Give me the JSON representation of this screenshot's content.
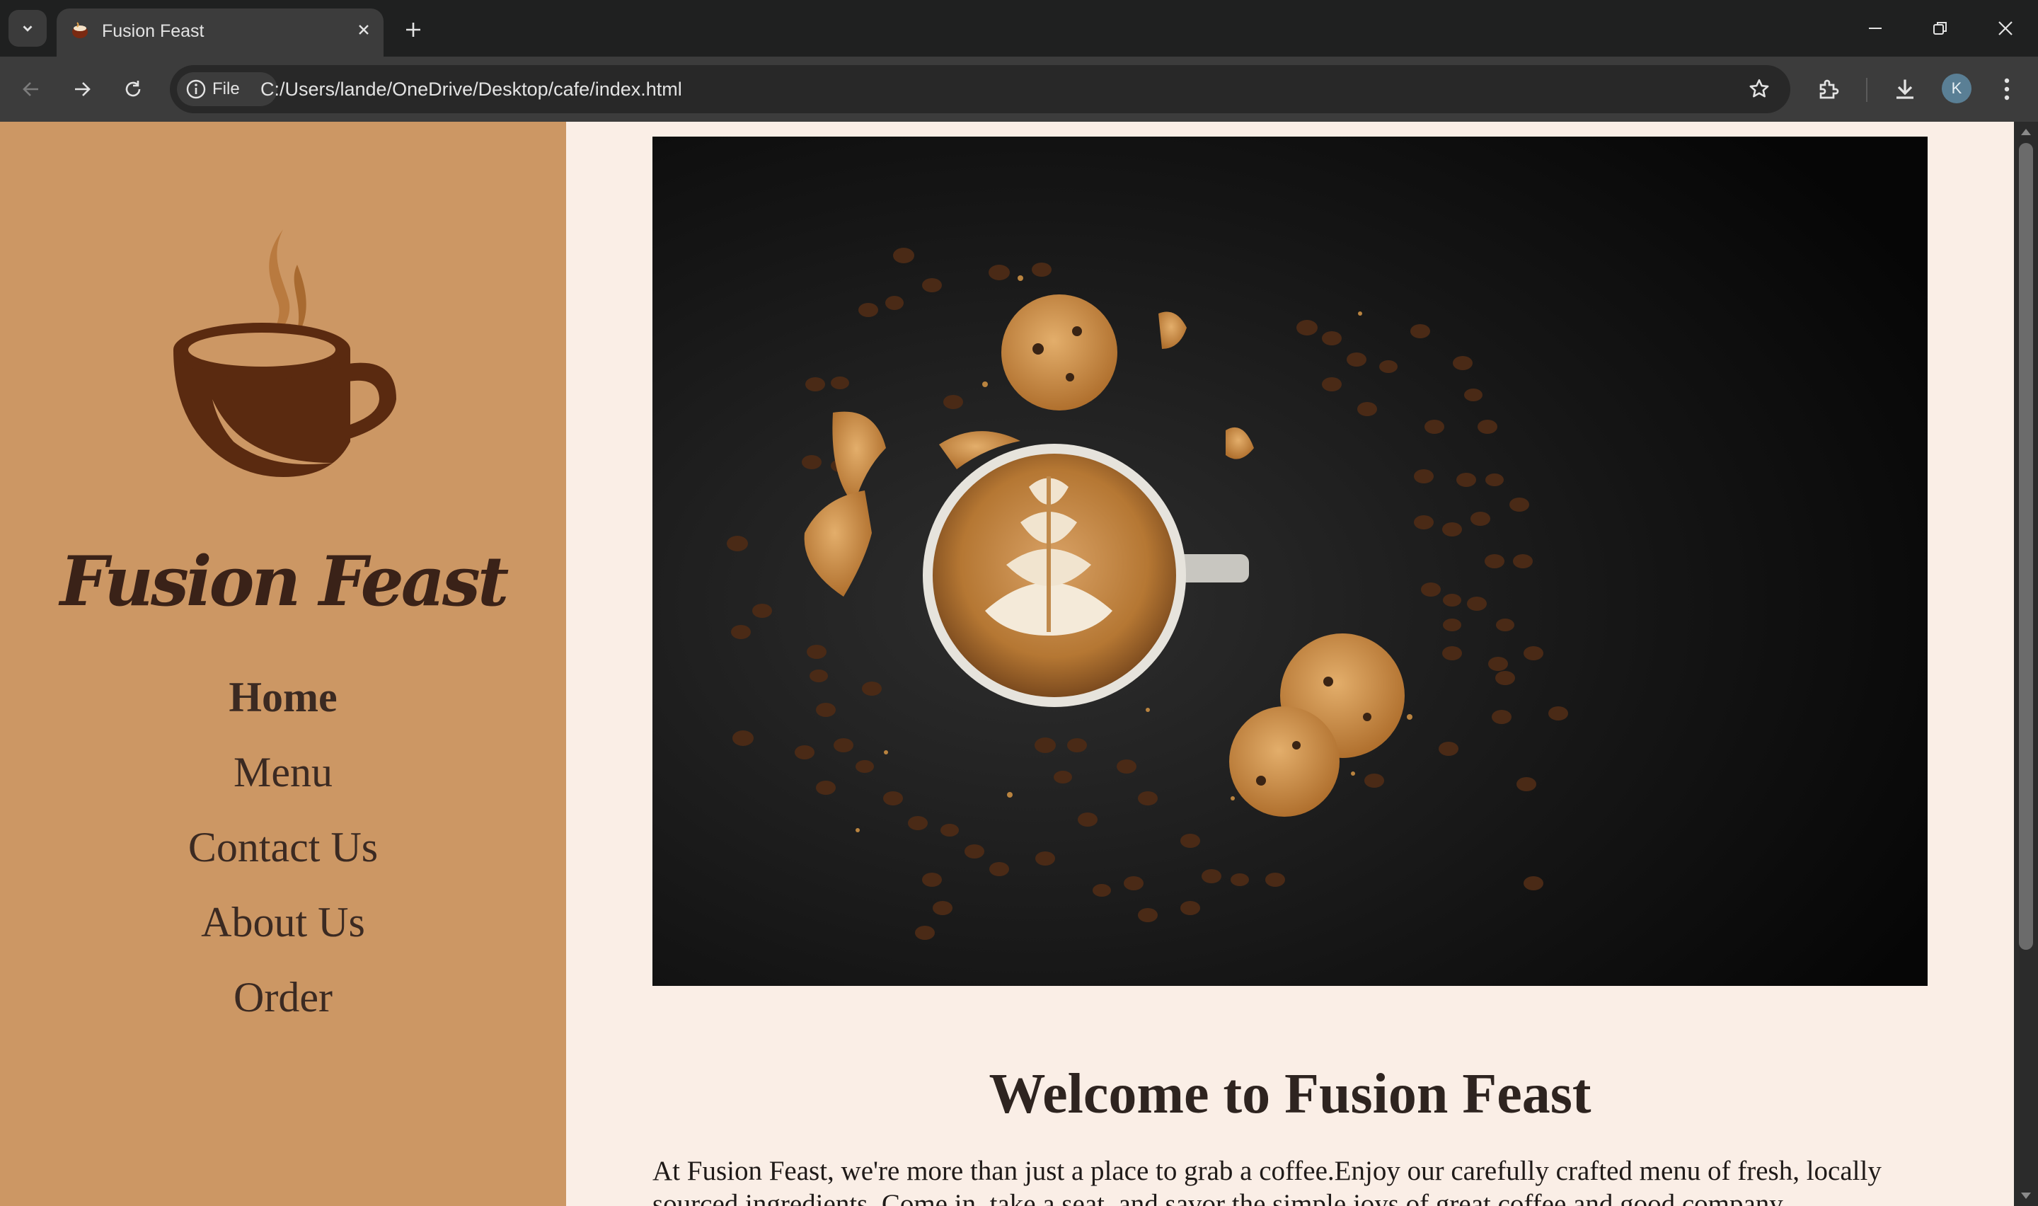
{
  "browser": {
    "tab_title": "Fusion Feast",
    "url_scheme_label": "File",
    "url": "C:/Users/lande/OneDrive/Desktop/cafe/index.html",
    "profile_initial": "K"
  },
  "sidebar": {
    "brand": "Fusion Feast",
    "nav": [
      {
        "label": "Home",
        "active": true
      },
      {
        "label": "Menu"
      },
      {
        "label": "Contact Us"
      },
      {
        "label": "About Us"
      },
      {
        "label": "Order"
      }
    ]
  },
  "main": {
    "welcome_title": "Welcome to Fusion Feast",
    "intro_text": "At Fusion Feast, we're more than just a place to grab a coffee.Enjoy our carefully crafted menu of fresh, locally sourced ingredients. Come in, take a seat, and savor the simple joys of great coffee and good company."
  },
  "colors": {
    "sidebar_bg": "#cc9764",
    "page_bg": "#faeee6",
    "brand_text": "#3a2218",
    "cup": "#5a2a10"
  }
}
